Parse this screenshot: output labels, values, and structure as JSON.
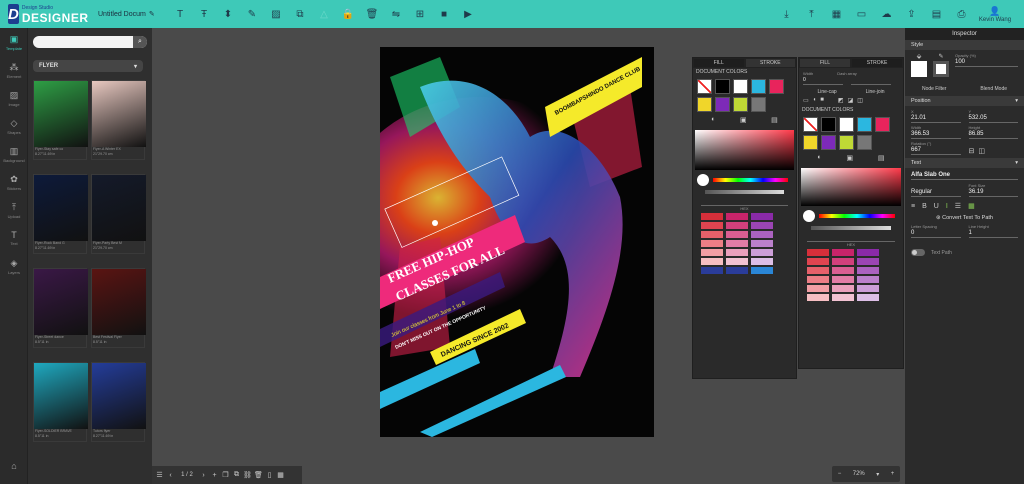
{
  "app": {
    "logo_sub": "Design Studio",
    "logo_main": "DESIGNER",
    "doc_title": "Untitled Docum",
    "user_name": "Kevin Wang"
  },
  "toolbar": {
    "left_icons": [
      "text-icon",
      "heading-icon",
      "shape-icon",
      "pen-icon",
      "image-icon",
      "clip-icon",
      "triangle-icon",
      "lock-icon",
      "trash-icon",
      "flip-icon",
      "align-icon",
      "video-icon",
      "play-icon"
    ],
    "right_icons": [
      "download-icon",
      "upload-icon",
      "grid-icon",
      "monitor-icon",
      "cloud-icon",
      "export-icon",
      "folder-icon",
      "print-icon"
    ]
  },
  "left_rail": [
    {
      "label": "Template",
      "icon": "template-icon"
    },
    {
      "label": "Element",
      "icon": "element-icon"
    },
    {
      "label": "Image",
      "icon": "image-icon"
    },
    {
      "label": "Shapes",
      "icon": "shapes-icon"
    },
    {
      "label": "Background",
      "icon": "background-icon"
    },
    {
      "label": "Stickers",
      "icon": "stickers-icon"
    },
    {
      "label": "Upload",
      "icon": "upload-icon"
    },
    {
      "label": "Text",
      "icon": "text-icon"
    },
    {
      "label": "Layers",
      "icon": "layers-icon"
    }
  ],
  "left_panel": {
    "search_placeholder": "",
    "category": "FLYER",
    "thumbnails": [
      {
        "caption": "Flyer-Stay safe co",
        "size": "8.27\"11.69 in",
        "color": "#2e9e45"
      },
      {
        "caption": "Flyer-A Winter EX",
        "size": "21\"29.70 cm",
        "color": "#e8c8c0"
      },
      {
        "caption": "Flyer-Rock Band G",
        "size": "8.27\"11.69 in",
        "color": "#0d1a3a"
      },
      {
        "caption": "Flyer-Party Best M",
        "size": "21\"29.70 cm",
        "color": "#141a2a"
      },
      {
        "caption": "Flyer-Street dance",
        "size": "8.5\"11 in",
        "color": "#3a1846"
      },
      {
        "caption": "Best Festival Flyer",
        "size": "8.5\"11 in",
        "color": "#5a1412"
      },
      {
        "caption": "Flyer-SOLDIER BRAVE",
        "size": "8.5\"11 in",
        "color": "#1fa9c0"
      },
      {
        "caption": "Tutors flyer",
        "size": "8.27\"11.69 in",
        "color": "#243d9a"
      }
    ],
    "home_label": "Projects"
  },
  "bottom_bar": {
    "page_indicator": "1 / 2",
    "zoom": "72%"
  },
  "poster": {
    "banner_top": "BOOMBAPSHINDO DANCE CLUB",
    "headline1": "FREE HIP-HOP",
    "headline2": "CLASSES FOR ALL",
    "join_text": "Join our classes from June 1 to 8",
    "dont_miss": "DON'T MISS OUT ON THE OPPORTUNITY",
    "dancing": "DANCING SINCE 2002"
  },
  "color_panel_1": {
    "tabs": [
      "FILL",
      "STROKE"
    ],
    "doc_colors_label": "DOCUMENT COLORS",
    "swatches": [
      "none",
      "#000000",
      "#ffffff",
      "#2bb7e0",
      "#e8245c",
      "#f0d62a",
      "#7d2ab8",
      "#bfd935",
      "#777777"
    ],
    "hex_label": "HEX",
    "palette": [
      "#d62f3a",
      "#c8246a",
      "#8a2aa8",
      "#e04450",
      "#d2407c",
      "#9b45b4",
      "#e6606a",
      "#da5e92",
      "#ab62c0",
      "#ec7e86",
      "#e27ca6",
      "#bb80cc",
      "#f29ea4",
      "#eaa0bc",
      "#cc9ed8",
      "#f6bec2",
      "#f2c2d2",
      "#dcbee6",
      "#2a3c9a",
      "#2a3c9a",
      "#2a86d6"
    ]
  },
  "color_panel_2": {
    "tabs": [
      "FILL",
      "STROKE"
    ],
    "width_label": "Width",
    "width_value": "0",
    "dash_label": "Dash array",
    "linecap_label": "Line-cap",
    "linejoin_label": "Line-join",
    "doc_colors_label": "DOCUMENT COLORS",
    "swatches": [
      "none",
      "#000000",
      "#ffffff",
      "#2bb7e0",
      "#e8245c",
      "#f0d62a",
      "#7d2ab8",
      "#bfd935",
      "#777777"
    ],
    "hex_label": "HEX",
    "palette": [
      "#d62f3a",
      "#c8246a",
      "#8a2aa8",
      "#e04450",
      "#d2407c",
      "#9b45b4",
      "#e6606a",
      "#da5e92",
      "#ab62c0",
      "#ec7e86",
      "#e27ca6",
      "#bb80cc",
      "#f29ea4",
      "#eaa0bc",
      "#cc9ed8",
      "#f6bec2",
      "#f2c2d2",
      "#dcbee6"
    ]
  },
  "inspector": {
    "title": "Inspector",
    "style_label": "Style",
    "opacity_label": "Opacity (%)",
    "opacity_value": "100",
    "node_filter": "Node Filter",
    "blend_mode": "Blend Mode",
    "position_label": "Position",
    "x_label": "X",
    "x_value": "21.01",
    "y_label": "Y",
    "y_value": "532.05",
    "width_label": "Width",
    "width_value": "366.53",
    "height_label": "Height",
    "height_value": "86.85",
    "rotation_label": "Rotation (°)",
    "rotation_value": "667",
    "text_label": "Text",
    "font_family": "Alfa Slab One",
    "font_style": "Regular",
    "font_size_label": "Font Size",
    "font_size": "36.19",
    "convert_path": "Convert Text To Path",
    "letter_spacing_label": "Letter Spacing",
    "letter_spacing": "0",
    "line_height_label": "Line Height",
    "line_height": "1",
    "text_path": "Text Path"
  }
}
